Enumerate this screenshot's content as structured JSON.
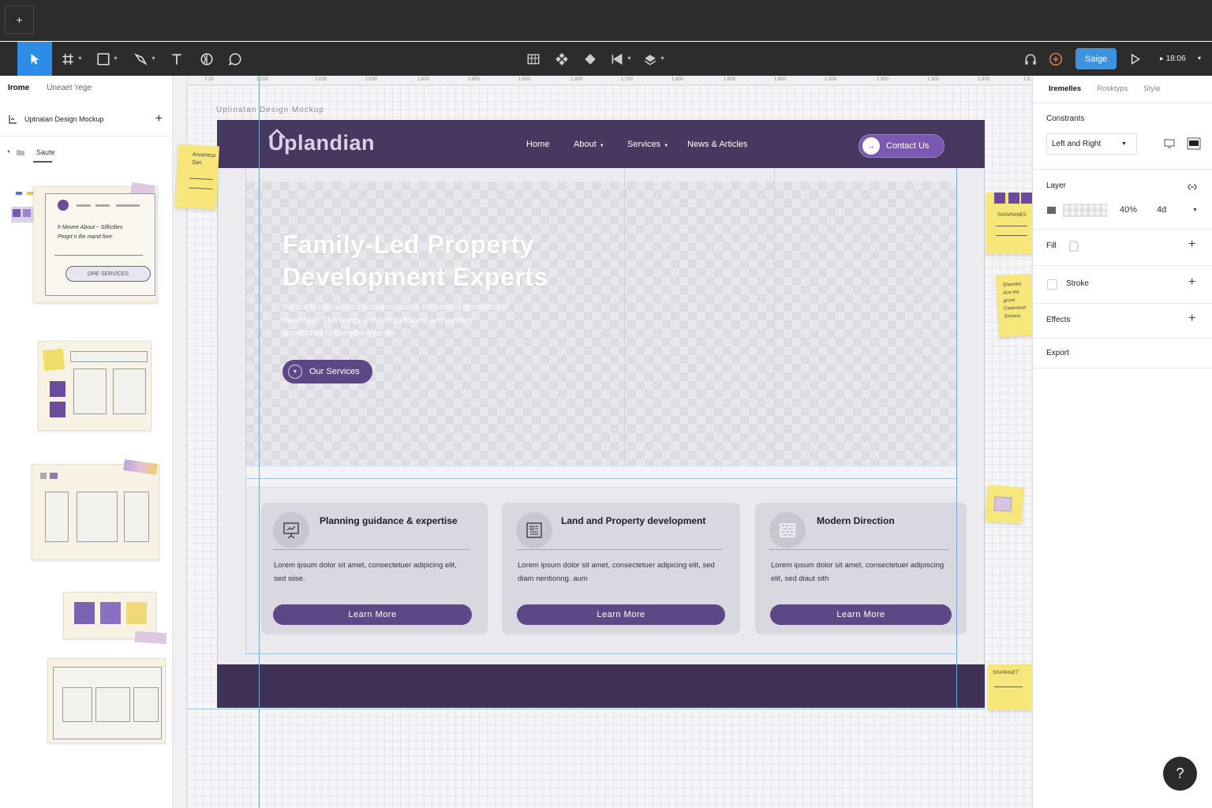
{
  "tabbar": {
    "add_label": "+"
  },
  "toolbar": {
    "share_label": "Saige",
    "zoom_label": "18:06"
  },
  "left_panel": {
    "tabs": [
      "Irome",
      "Uneaet 'rege"
    ],
    "file_name": "Uptnalan Design Mockup",
    "page_name": "Saute",
    "thumb1": {
      "nav_line": "h Movee   About ~ Sifkctlies",
      "sub_line": "Ptogrt n ifie mand fore:",
      "button": "ORE SERVICES"
    }
  },
  "ruler": {
    "ticks": [
      "7:20",
      "1:200",
      "1:030",
      "1:030",
      "1:800",
      "1:600",
      "1:600",
      "1:800",
      "1:700",
      "1:800",
      "1:800",
      "1:800",
      "1:300",
      "1:300",
      "1:300",
      "1:300",
      "1:5"
    ]
  },
  "canvas": {
    "frame_label": "Uplinatan Design Mockup",
    "logo": "Uplandian",
    "nav": [
      "Home",
      "About",
      "Services",
      "News & Articles"
    ],
    "contact": "Contact Us",
    "hero": {
      "title": "Family-Led Property Development Experts",
      "subtitle": "We are family oprated business, now in the second generation of ownership. This brings a mix of traditional and modern approcches to everything we do.",
      "button": "Our Services"
    },
    "cards": [
      {
        "title": "Planning guidance & expertise",
        "text": "Lorem ipsum dolor sit amet, consectetuer adipicing elit, sed siise.",
        "button": "Learn More",
        "icon": "presentation-board-icon"
      },
      {
        "title": "Land and Property development",
        "text": "Lorem ipsum dolor sit amet, consectetuer adipicing elit, sed diam nentionng. aum",
        "button": "Learn More",
        "icon": "blueprint-icon"
      },
      {
        "title": "Modern Direction",
        "text": "Lorem ipsum dolor sit amet, consectetuer adipiscing elit, sed diaut sith",
        "button": "Learn More",
        "icon": "brick-wall-icon"
      }
    ],
    "sticky_notes": {
      "left": "Anoentsa San",
      "right1": "SHAVHANES",
      "right2": "Shannhe Aoe the grvmi Ceahvlose Sonava",
      "right3": "SHANHAET"
    }
  },
  "right_panel": {
    "tabs": [
      "Iremelles",
      "Rosktyps",
      "Style"
    ],
    "constraints_label": "Constrants",
    "constraints_value": "Left and Right",
    "layer_label": "Layer",
    "layer_opacity": "40%",
    "layer_blend": "4d",
    "fill_label": "Fill",
    "stroke_label": "Stroke",
    "effects_label": "Effects",
    "export_label": "Export"
  },
  "help_label": "?",
  "colors": {
    "brand_purple": "#46385e",
    "button_purple": "#5e4785",
    "accent_blue": "#2d8de6",
    "sticky_yellow": "#f7e77a"
  }
}
